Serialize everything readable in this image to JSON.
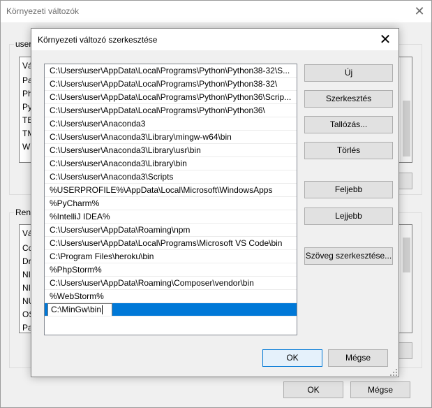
{
  "outer_window": {
    "title": "Környezeti változók",
    "user_group_label": "user",
    "user_list_items": [
      "Vá",
      "Pa",
      "Ph",
      "Py",
      "TE",
      "TM",
      "W"
    ],
    "system_group_label": "Rend",
    "system_list_items": [
      "Vá",
      "Co",
      "Dr",
      "NI",
      "NI",
      "NU",
      "OS",
      "Pa"
    ],
    "ok_label": "OK",
    "cancel_label": "Mégse"
  },
  "modal": {
    "title": "Környezeti változó szerkesztése",
    "paths": [
      "C:\\Users\\user\\AppData\\Local\\Programs\\Python\\Python38-32\\S...",
      "C:\\Users\\user\\AppData\\Local\\Programs\\Python\\Python38-32\\",
      "C:\\Users\\user\\AppData\\Local\\Programs\\Python\\Python36\\Scrip...",
      "C:\\Users\\user\\AppData\\Local\\Programs\\Python\\Python36\\",
      "C:\\Users\\user\\Anaconda3",
      "C:\\Users\\user\\Anaconda3\\Library\\mingw-w64\\bin",
      "C:\\Users\\user\\Anaconda3\\Library\\usr\\bin",
      "C:\\Users\\user\\Anaconda3\\Library\\bin",
      "C:\\Users\\user\\Anaconda3\\Scripts",
      "%USERPROFILE%\\AppData\\Local\\Microsoft\\WindowsApps",
      "%PyCharm%",
      "%IntelliJ IDEA%",
      "C:\\Users\\user\\AppData\\Roaming\\npm",
      "C:\\Users\\user\\AppData\\Local\\Programs\\Microsoft VS Code\\bin",
      "C:\\Program Files\\heroku\\bin",
      "%PhpStorm%",
      "C:\\Users\\user\\AppData\\Roaming\\Composer\\vendor\\bin",
      "%WebStorm%"
    ],
    "editing_value": "C:\\MinGw\\bin",
    "buttons": {
      "new": "Új",
      "edit": "Szerkesztés",
      "browse": "Tallózás...",
      "delete": "Törlés",
      "move_up": "Feljebb",
      "move_down": "Lejjebb",
      "edit_text": "Szöveg szerkesztése...",
      "ok": "OK",
      "cancel": "Mégse"
    }
  },
  "colors": {
    "selection": "#0078d7",
    "dialog_bg": "#f0f0f0",
    "button_bg": "#e1e1e1"
  }
}
